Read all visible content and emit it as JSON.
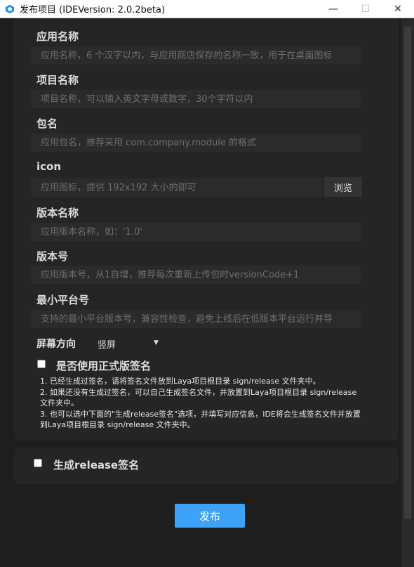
{
  "window": {
    "title": "发布项目 (IDEVersion: 2.0.2beta)",
    "minimize": "—",
    "maximize": "☐",
    "close": "✕"
  },
  "fields": [
    {
      "label": "应用名称",
      "placeholder": "应用名称，6 个汉字以内，与应用商店保存的名称一致，用于在桌面图标"
    },
    {
      "label": "项目名称",
      "placeholder": "项目名称，可以输入英文字母或数字，30个字符以内"
    },
    {
      "label": "包名",
      "placeholder": "应用包名，推荐采用 com.company.module 的格式"
    },
    {
      "label": "icon",
      "placeholder": "应用图标，提供 192x192 大小的即可"
    },
    {
      "label": "版本名称",
      "placeholder": "应用版本名称，如：'1.0'"
    },
    {
      "label": "版本号",
      "placeholder": "应用版本号，从1自增，推荐每次重新上传包时versionCode+1"
    },
    {
      "label": "最小平台号",
      "placeholder": "支持的最小平台版本号，兼容性检查，避免上线后在低版本平台运行并导"
    }
  ],
  "browse_label": "浏览",
  "orientation": {
    "label": "屏幕方向",
    "value": "竖屏",
    "arrow": "▼"
  },
  "release_sign": {
    "label": "是否使用正式版签名",
    "notes": [
      "1. 已经生成过签名，请将签名文件放到Laya项目根目录 sign/release 文件夹中。",
      "2. 如果还没有生成过签名，可以自己生成签名文件，并放置到Laya项目根目录 sign/release",
      "文件夹中。",
      "3. 也可以选中下面的\"生成release签名\"选项，并填写对应信息，IDE将会生成签名文件并放置",
      "到Laya项目根目录 sign/release 文件夹中。"
    ]
  },
  "generate_sign": {
    "label": "生成release签名"
  },
  "publish_label": "发布"
}
